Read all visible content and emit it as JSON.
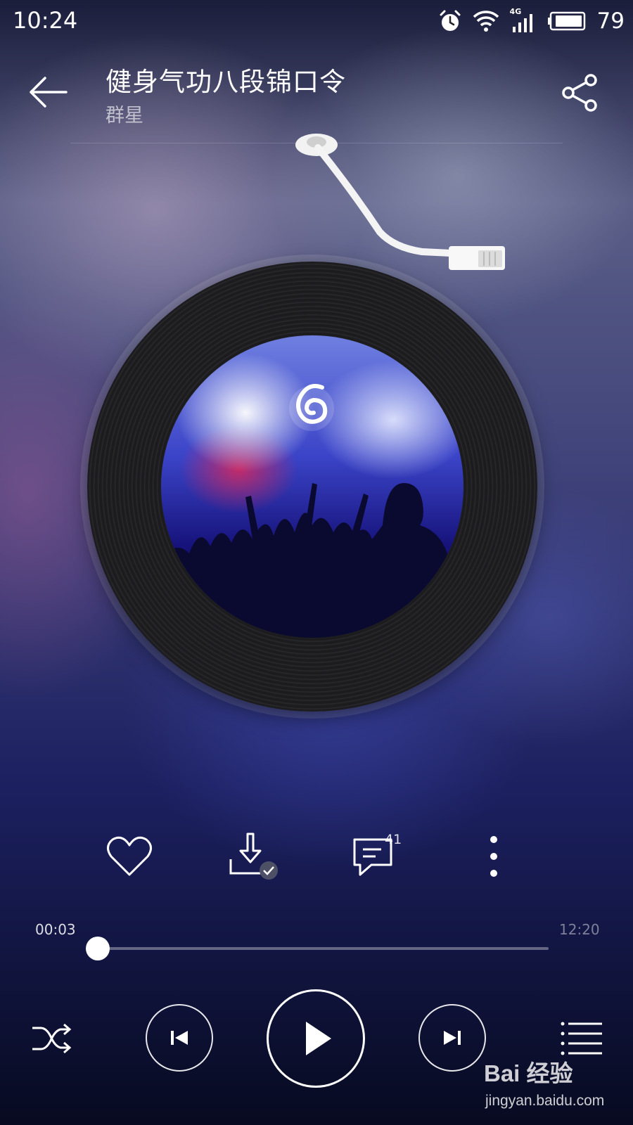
{
  "status_bar": {
    "time": "10:24",
    "network": "4G",
    "battery_percent": "79",
    "icons": [
      "alarm-icon",
      "wifi-icon",
      "signal-icon",
      "battery-icon"
    ]
  },
  "header": {
    "title": "健身气功八段锦口令",
    "artist": "群星",
    "back_icon": "back-arrow-icon",
    "share_icon": "share-icon"
  },
  "player": {
    "cover_logo": "music-app-logo-icon",
    "actions": {
      "like_icon": "heart-icon",
      "download_icon": "download-done-icon",
      "comment_icon": "comment-icon",
      "comment_count": "41",
      "more_icon": "more-vertical-icon"
    },
    "progress": {
      "current": "00:03",
      "total": "12:20",
      "fraction": 0.004
    },
    "controls": [
      "shuffle-icon",
      "previous-icon",
      "play-icon",
      "next-icon",
      "playlist-icon"
    ]
  },
  "watermark": {
    "brand": "Bai 经验",
    "url": "jingyan.baidu.com"
  },
  "colors": {
    "accent": "#ffffff",
    "background_dark": "#0c1030"
  }
}
